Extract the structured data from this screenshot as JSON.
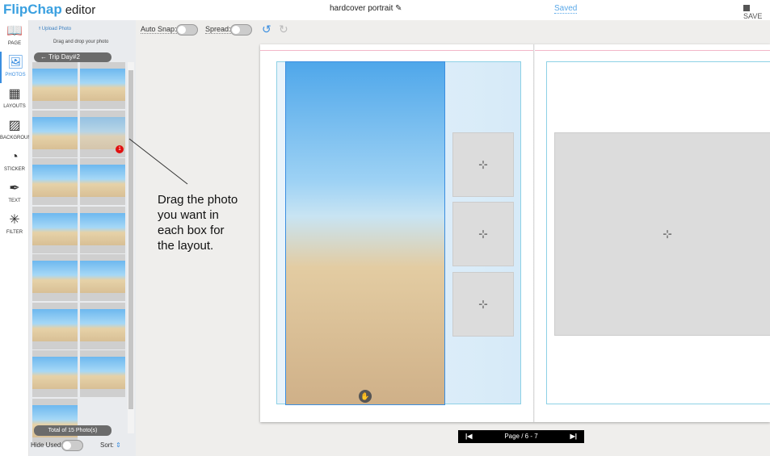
{
  "header": {
    "logo": "FlipChap",
    "logo_suffix": "editor",
    "title": "hardcover portrait",
    "status": "Saved",
    "save_label": "SAVE"
  },
  "rail": [
    {
      "label": "PAGE",
      "icon": "book-icon"
    },
    {
      "label": "PHOTOS",
      "icon": "image-icon"
    },
    {
      "label": "LAYOUTS",
      "icon": "layouts-icon"
    },
    {
      "label": "BACKGROUND",
      "icon": "background-icon"
    },
    {
      "label": "STICKER",
      "icon": "sticker-icon"
    },
    {
      "label": "TEXT",
      "icon": "pen-icon"
    },
    {
      "label": "FILTER",
      "icon": "magic-wand-icon"
    }
  ],
  "panel": {
    "upload": "Upload Photo",
    "hint": "Drag and drop your photo",
    "album": "Trip Day#2",
    "total": "Total of 15 Photo(s)",
    "hide_used": "Hide Used:",
    "sort": "Sort:",
    "used_badge": "1",
    "photo_count": 15
  },
  "toolbar": {
    "auto_snap": "Auto Snap:",
    "spread": "Spread:"
  },
  "annotation": [
    "Drag the photo",
    "you want in",
    "each box for",
    "the layout."
  ],
  "pagenav": {
    "label": "Page / 6 - 7"
  },
  "colors": {
    "accent": "#3a8ee0",
    "badge": "#e01010"
  }
}
